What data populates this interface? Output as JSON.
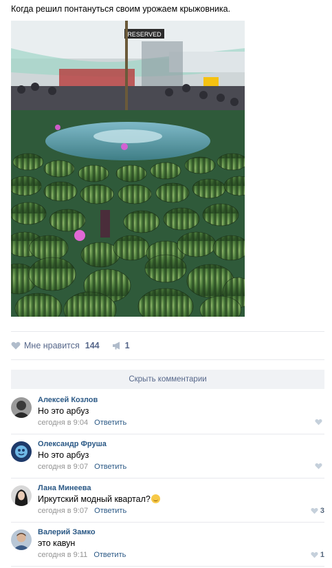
{
  "post": {
    "text": "Когда решил понтануться своим урожаем крыжовника."
  },
  "actions": {
    "like_label": "Мне нравится",
    "like_count": "144",
    "share_count": "1"
  },
  "comments_toggle": "Скрыть комментарии",
  "comments": [
    {
      "author": "Алексей Козлов",
      "text": "Но это арбуз",
      "time": "сегодня в 9:04",
      "reply": "Ответить",
      "likes": ""
    },
    {
      "author": "Олександр Фруша",
      "text": "Но это арбуз",
      "time": "сегодня в 9:07",
      "reply": "Ответить",
      "likes": ""
    },
    {
      "author": "Лана Минеева",
      "text": "Иркутский модный квартал?",
      "time": "сегодня в 9:07",
      "reply": "Ответить",
      "likes": "3"
    },
    {
      "author": "Валерий Замко",
      "text": "это кавун",
      "time": "сегодня в 9:11",
      "reply": "Ответить",
      "likes": "1"
    }
  ],
  "colors": {
    "link": "#2a5885",
    "muted": "#939393",
    "action": "#56678a",
    "divider": "#e7e8ec"
  }
}
